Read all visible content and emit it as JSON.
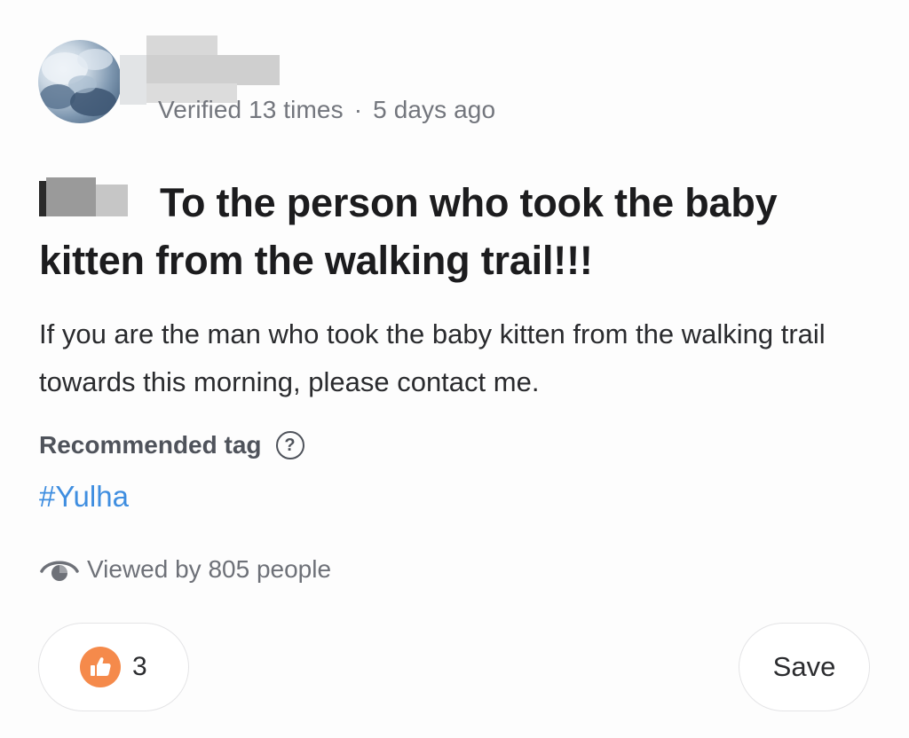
{
  "header": {
    "verified_text": "Verified 13 times",
    "separator": "·",
    "time_ago": "5 days ago"
  },
  "post": {
    "title": "To the person who took the baby kitten from the walking trail!!!",
    "body": "If you are the man who took the baby kitten from the walking trail towards this morning, please contact me."
  },
  "tags": {
    "label": "Recommended tag",
    "help_icon": "?",
    "items": [
      "#Yulha"
    ]
  },
  "views": {
    "icon": "eye-icon",
    "text": "Viewed by 805 people"
  },
  "actions": {
    "like_icon": "thumbs-up-icon",
    "like_count": "3",
    "save_label": "Save"
  },
  "colors": {
    "hashtag": "#3f8ee0",
    "like_accent": "#f58a4b",
    "meta_text": "#73767d"
  }
}
